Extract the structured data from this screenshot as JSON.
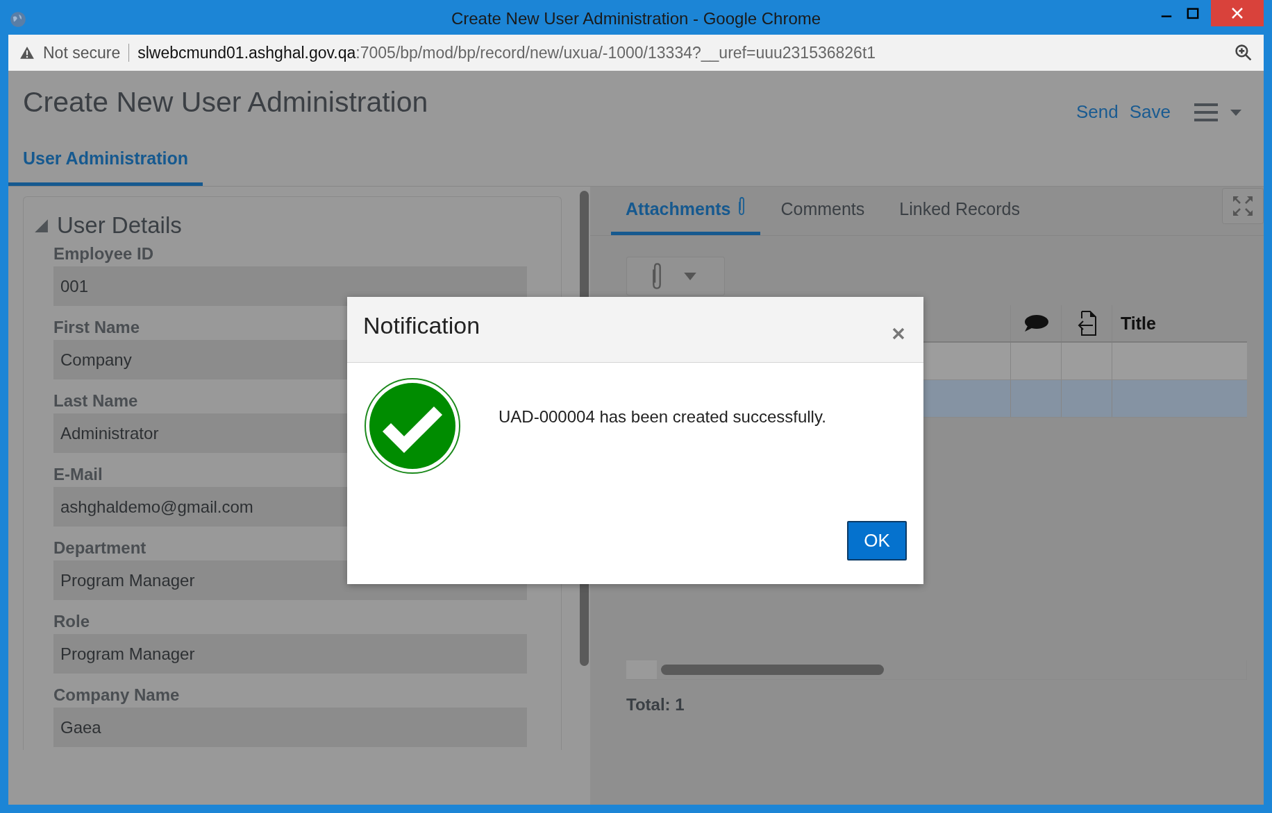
{
  "window": {
    "title": "Create New User Administration - Google Chrome"
  },
  "address_bar": {
    "security": "Not secure",
    "url_host": "slwebcmund01.ashghal.gov.qa",
    "url_path": ":7005/bp/mod/bp/record/new/uxua/-1000/13334?__uref=uuu231536826t1"
  },
  "page": {
    "title": "Create New User Administration",
    "actions": [
      "Send",
      "Save"
    ]
  },
  "tabs": [
    {
      "label": "User Administration",
      "selected": true
    }
  ],
  "section": {
    "title": "User Details",
    "expanded": true,
    "fields": [
      {
        "label": "Employee ID",
        "value": "001"
      },
      {
        "label": "First Name",
        "value": "Company"
      },
      {
        "label": "Last Name",
        "value": "Administrator"
      },
      {
        "label": "E-Mail",
        "value": "ashghaldemo@gmail.com"
      },
      {
        "label": "Department",
        "value": "Program Manager"
      },
      {
        "label": "Role",
        "value": "Program Manager"
      },
      {
        "label": "Company Name",
        "value": "Gaea"
      }
    ]
  },
  "side_tabs": [
    {
      "label": "Attachments",
      "selected": true,
      "kind": "attachments"
    },
    {
      "label": "Comments",
      "selected": false,
      "kind": "plain"
    },
    {
      "label": "Linked Records",
      "selected": false,
      "kind": "plain"
    }
  ],
  "attachments_table": {
    "columns": [
      {
        "kind": "comment"
      },
      {
        "kind": "file"
      },
      {
        "kind": "text",
        "label": "Title"
      }
    ],
    "rows": [
      {
        "selected": false
      },
      {
        "selected": true
      }
    ],
    "total": "Total: 1"
  },
  "dialog": {
    "title": "Notification",
    "message": "UAD-000004 has been created successfully.",
    "button": "OK"
  }
}
